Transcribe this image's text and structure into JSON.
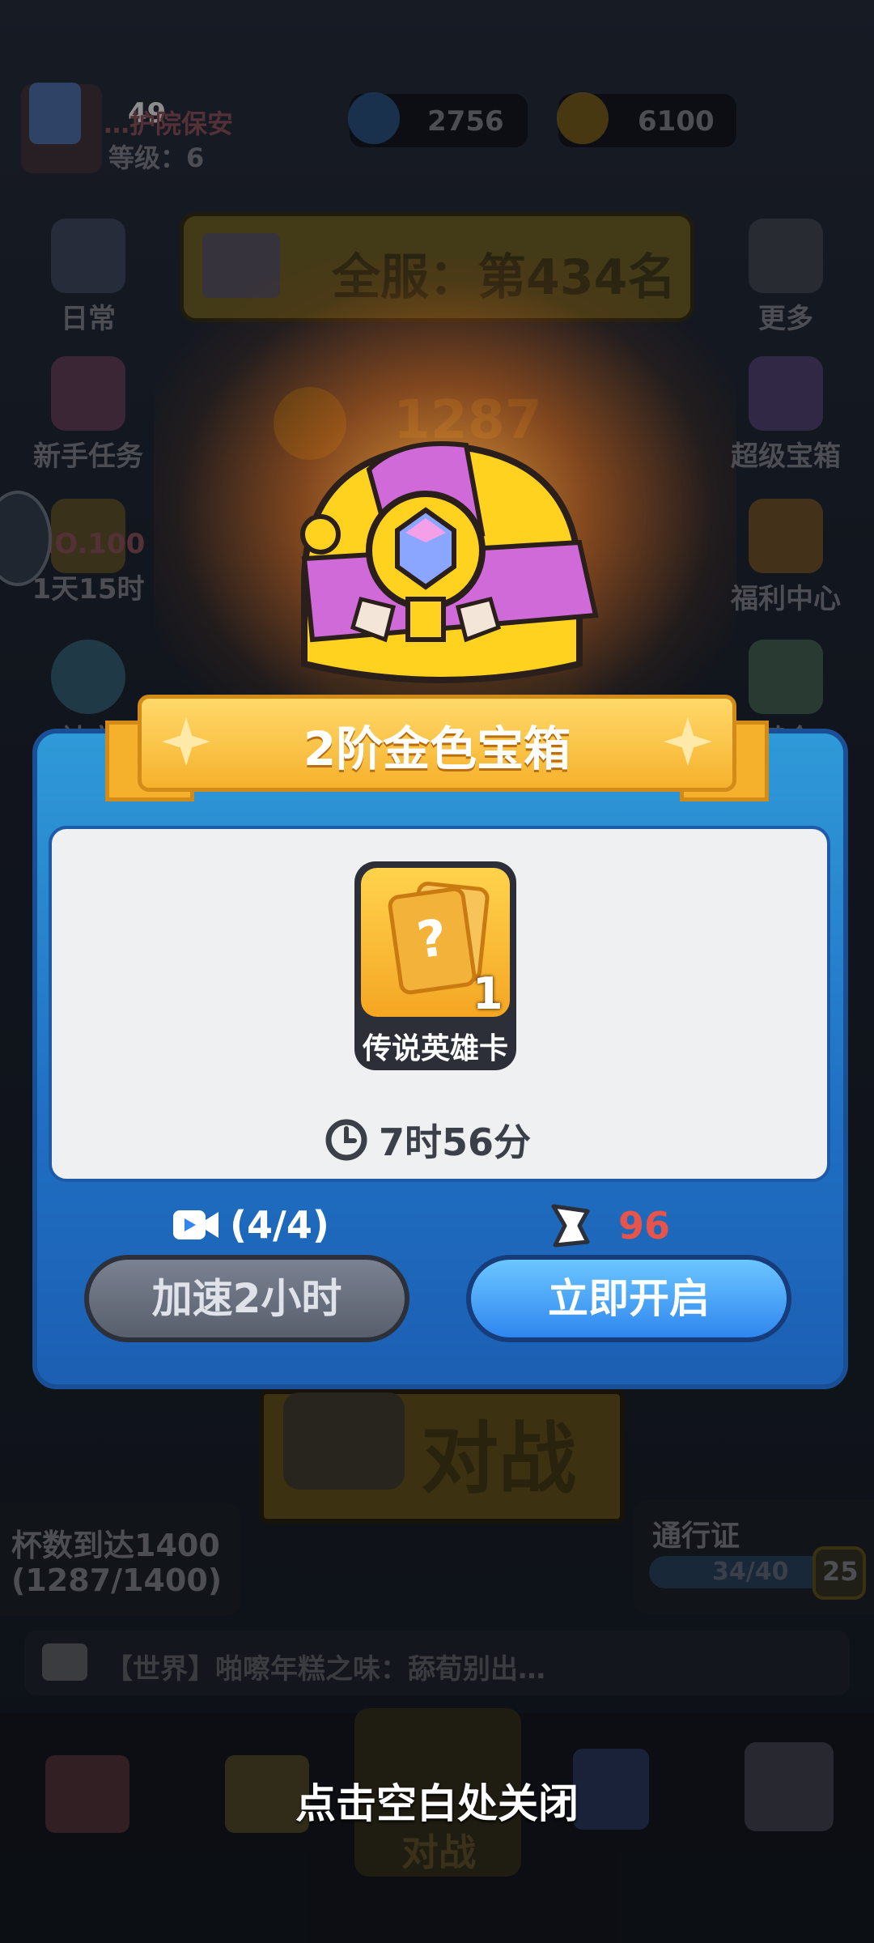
{
  "header": {
    "player_name": "…护院保安",
    "player_level": "等级：6",
    "energy": "49",
    "gems": "2756",
    "coins": "6100"
  },
  "rank_banner": "全服：第434名",
  "trophies": "1287",
  "side_left": [
    {
      "label": "日常",
      "icon": "clipboard-icon"
    },
    {
      "label": "新手任务",
      "icon": "calendar-7-icon"
    },
    {
      "label": "NO.100",
      "sub": "1天15时",
      "icon": "ranking-icon"
    },
    {
      "label": "社交",
      "icon": "chat-icon"
    }
  ],
  "side_right": [
    {
      "label": "更多",
      "icon": "menu-icon"
    },
    {
      "label": "超级宝箱",
      "icon": "chest-icon"
    },
    {
      "label": "福利中心",
      "icon": "gift-icon"
    },
    {
      "label": "基金",
      "icon": "fund-icon"
    }
  ],
  "modal": {
    "title": "2阶金色宝箱",
    "reward_name": "传说英雄卡",
    "reward_count": "1",
    "reward_symbol": "?",
    "timer": "7时56分",
    "video_count": "(4/4)",
    "cost": "96",
    "speedup_button": "加速2小时",
    "open_button": "立即开启"
  },
  "battle_button": "对战",
  "trophy_goal": {
    "line1": "杯数到达1400",
    "line2": "(1287/1400)"
  },
  "pass": {
    "label": "通行证",
    "progress": "34/40",
    "level": "25"
  },
  "chat": "【世界】啪嚓年糕之味：舔荀别出…",
  "bottom_nav": {
    "center_label": "对战"
  },
  "close_hint": "点击空白处关闭",
  "colors": {
    "modal_blue": "#2f86ef",
    "ribbon_gold": "#f6b12c",
    "cost_red": "#e8534a"
  }
}
